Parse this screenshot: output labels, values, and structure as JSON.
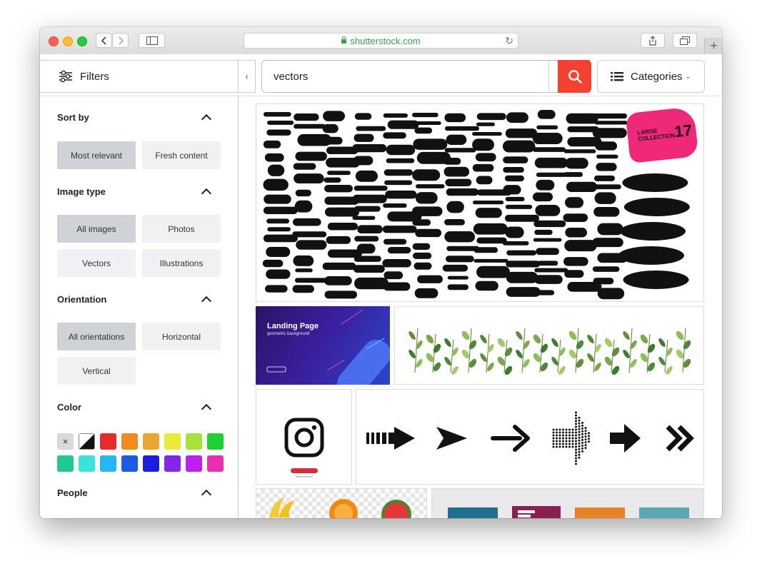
{
  "browser": {
    "url": "shutterstock.com"
  },
  "topbar": {
    "filters_label": "Filters",
    "collapse_glyph": "‹",
    "search_value": "vectors",
    "categories_label": "Categories"
  },
  "sidebar": {
    "sort_by": {
      "title": "Sort by",
      "options": [
        "Most relevant",
        "Fresh content"
      ],
      "selected": "Most relevant"
    },
    "image_type": {
      "title": "Image type",
      "options": [
        "All images",
        "Photos",
        "Vectors",
        "Illustrations"
      ],
      "selected": "All images"
    },
    "orientation": {
      "title": "Orientation",
      "options": [
        "All orientations",
        "Horizontal",
        "Vertical"
      ],
      "selected": "All orientations"
    },
    "color": {
      "title": "Color",
      "clear_glyph": "×",
      "swatches": [
        "#e52b2b",
        "#f18a1f",
        "#e9a633",
        "#e8ec36",
        "#a5e23a",
        "#1ed233",
        "#22c98f",
        "#38e3dc",
        "#25b6f4",
        "#1c5be8",
        "#1b1ee0",
        "#8126eb",
        "#bc1ff0",
        "#e92fae"
      ]
    },
    "people": {
      "title": "People"
    }
  },
  "results": {
    "landing": {
      "title": "Landing Page",
      "subtitle": "geometric background"
    },
    "grunge": {
      "badge_line1": "LARGE",
      "badge_line2": "COLLECTION",
      "badge_number": "17"
    }
  },
  "colors": {
    "accent": "#f5412f",
    "url_green": "#3a9e4a"
  }
}
